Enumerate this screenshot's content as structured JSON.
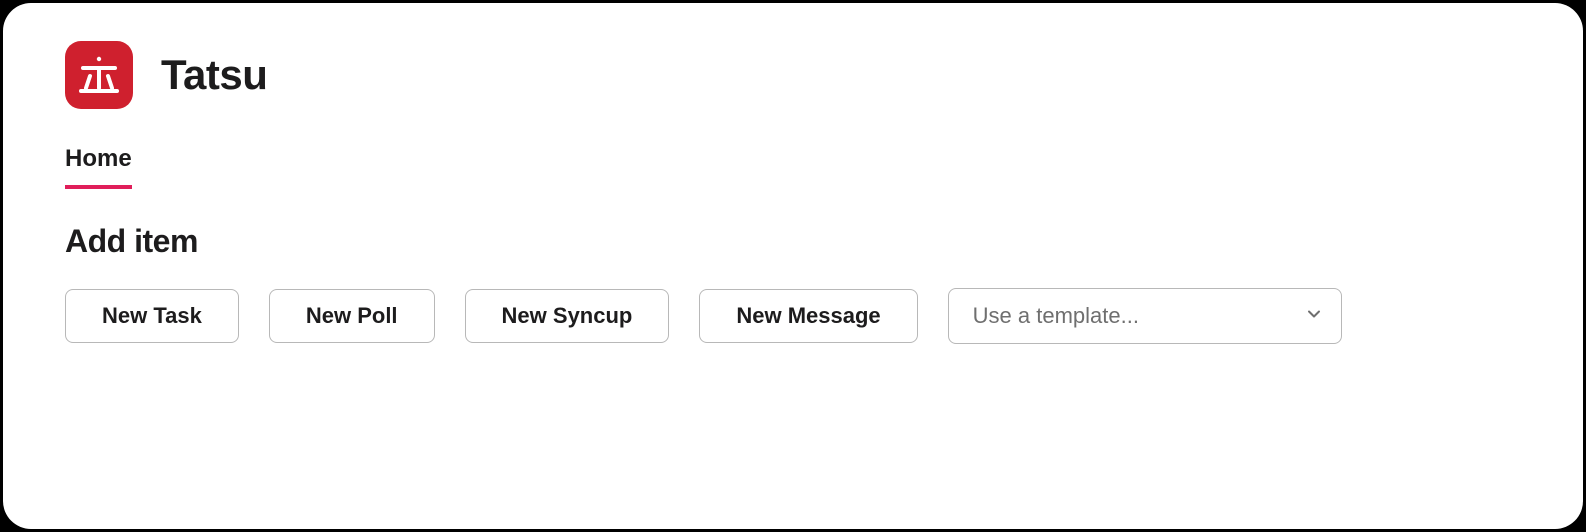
{
  "app": {
    "name": "Tatsu",
    "icon_glyph": "立"
  },
  "tabs": [
    {
      "label": "Home",
      "active": true
    }
  ],
  "section": {
    "title": "Add item"
  },
  "actions": {
    "new_task": "New Task",
    "new_poll": "New Poll",
    "new_syncup": "New Syncup",
    "new_message": "New Message"
  },
  "template_select": {
    "placeholder": "Use a template..."
  },
  "colors": {
    "brand": "#cf202e",
    "tab_underline": "#e01e5a"
  }
}
